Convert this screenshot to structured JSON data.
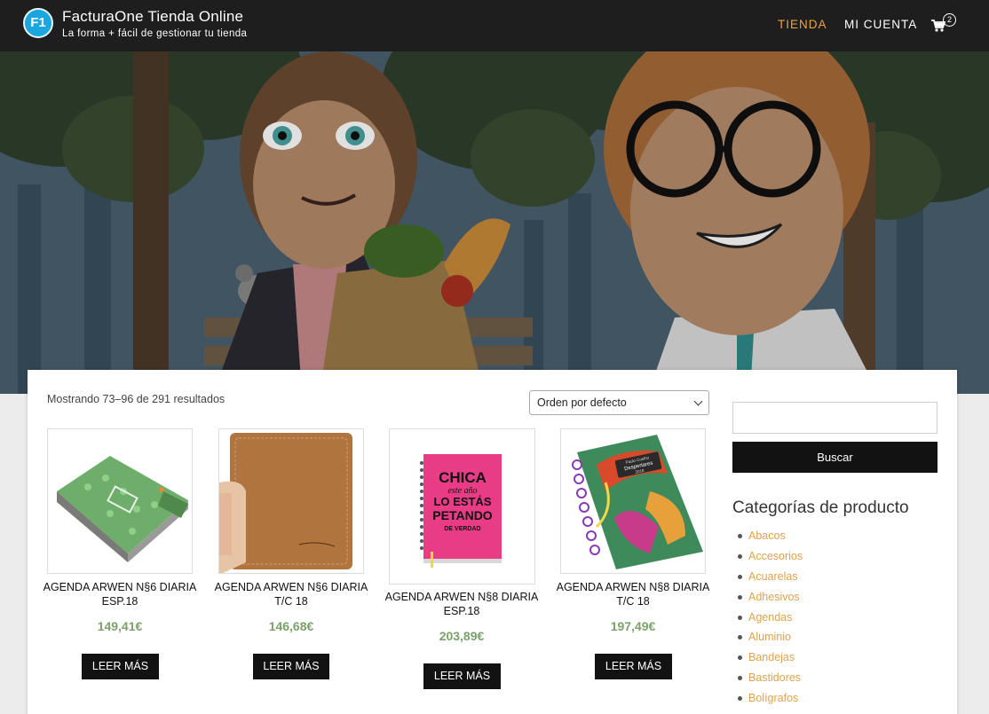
{
  "header": {
    "logo_text": "F1",
    "title": "FacturaOne Tienda Online",
    "tagline": "La forma + fácil de gestionar tu tienda",
    "nav": [
      "TIENDA",
      "MI CUENTA"
    ],
    "cart_count": "2",
    "accent_color": "#f0a23c"
  },
  "shop": {
    "result_count": "Mostrando 73–96 de 291 resultados",
    "orderby_selected": "Orden por defecto",
    "button_label": "LEER MÁS",
    "products": [
      {
        "title": "AGENDA ARWEN N§6 DIARIA ESP.18",
        "price": "149,41€"
      },
      {
        "title": "AGENDA ARWEN N§6 DIARIA T/C 18",
        "price": "146,68€"
      },
      {
        "title": "AGENDA ARWEN N§8 DIARIA ESP.18",
        "price": "203,89€"
      },
      {
        "title": "AGENDA ARWEN N§8 DIARIA T/C 18",
        "price": "197,49€"
      }
    ],
    "price_color": "#7aa26a"
  },
  "sidebar": {
    "search_button": "Buscar",
    "categories_title": "Categorías de producto",
    "categories": [
      "Abacos",
      "Accesorios",
      "Acuarelas",
      "Adhesivos",
      "Agendas",
      "Aluminio",
      "Bandejas",
      "Bastidores",
      "Bolígrafos"
    ],
    "link_color": "#e0a24e"
  },
  "product_images": {
    "p3_cover_lines": [
      "CHICA",
      "este año",
      "LO ESTÁS",
      "PETANDO",
      "DE VERDAD"
    ],
    "p4_cover_lines": [
      "Paulo Coelho",
      "Despertares",
      "2018"
    ]
  }
}
